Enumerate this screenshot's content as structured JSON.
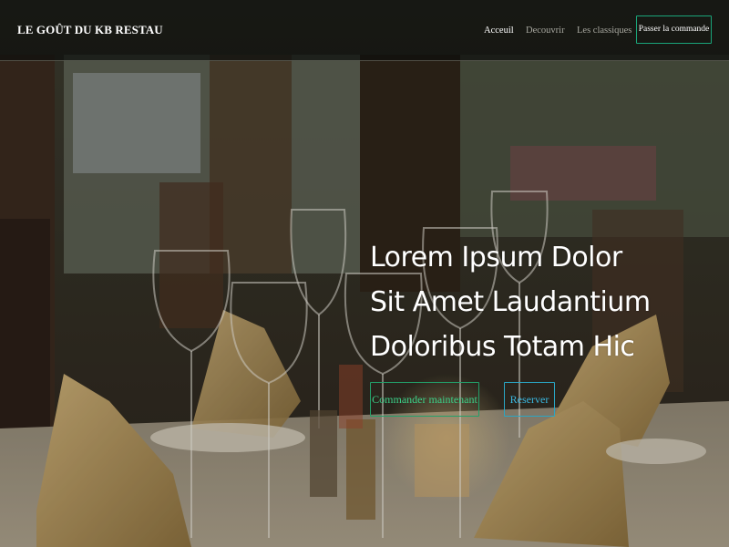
{
  "navbar": {
    "brand": "LE GOÛT DU KB RESTAU",
    "links": [
      {
        "label": "Acceuil",
        "active": true
      },
      {
        "label": "Decouvrir",
        "active": false
      },
      {
        "label": "Les classiques",
        "active": false
      }
    ],
    "cta_label": "Passer la commande"
  },
  "hero": {
    "headline_lines": [
      "Lorem Ipsum Dolor",
      "Sit Amet Laudantium",
      "Doloribus Totam Hic"
    ],
    "primary_button": "Commander maintenant",
    "secondary_button": "Reserver",
    "background_image": "restaurant-table-photo"
  },
  "colors": {
    "nav_bg": "#0c0e0d",
    "cta_border": "#1aa57a",
    "primary_btn": "#3cd088",
    "secondary_btn": "#3ab8e0",
    "text_light": "#ffffff",
    "text_muted": "#a8a8a0"
  }
}
